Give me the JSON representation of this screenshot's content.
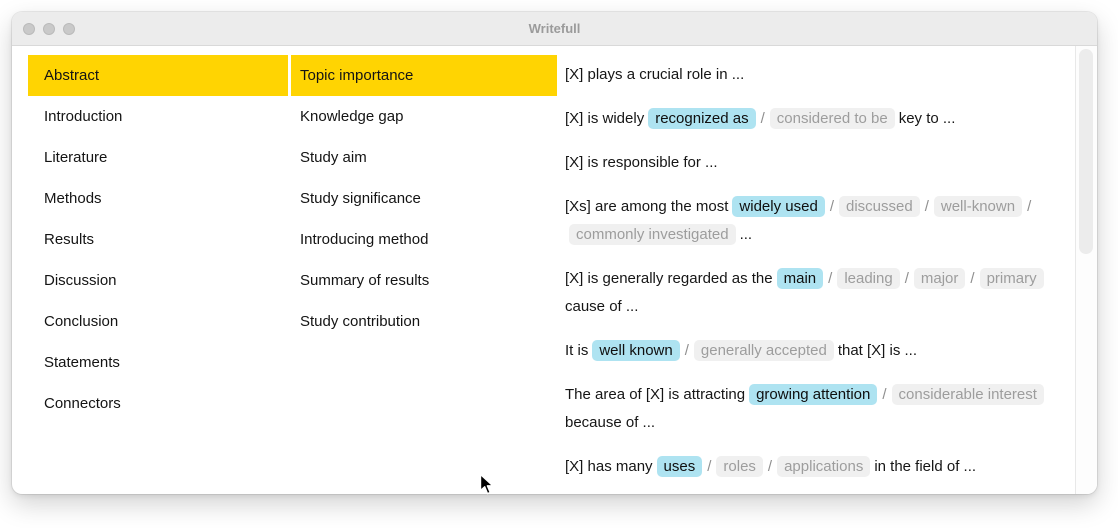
{
  "window": {
    "title": "Writefull",
    "controls": [
      "close",
      "minimize",
      "zoom"
    ]
  },
  "colors": {
    "selection_yellow": "#ffd402",
    "highlight_blue": "#aee3f1",
    "alternative_gray_bg": "#f0f0f0",
    "alternative_gray_text": "#9d9d9d",
    "titlebar_gray": "#ececec"
  },
  "icons": {
    "cursor": "arrow-pointer"
  },
  "sections": {
    "items": [
      {
        "label": "Abstract",
        "selected": true
      },
      {
        "label": "Introduction",
        "selected": false
      },
      {
        "label": "Literature",
        "selected": false
      },
      {
        "label": "Methods",
        "selected": false
      },
      {
        "label": "Results",
        "selected": false
      },
      {
        "label": "Discussion",
        "selected": false
      },
      {
        "label": "Conclusion",
        "selected": false
      },
      {
        "label": "Statements",
        "selected": false
      },
      {
        "label": "Connectors",
        "selected": false
      }
    ]
  },
  "topics": {
    "items": [
      {
        "label": "Topic importance",
        "selected": true
      },
      {
        "label": "Knowledge gap",
        "selected": false
      },
      {
        "label": "Study aim",
        "selected": false
      },
      {
        "label": "Study significance",
        "selected": false
      },
      {
        "label": "Introducing method",
        "selected": false
      },
      {
        "label": "Summary of results",
        "selected": false
      },
      {
        "label": "Study contribution",
        "selected": false
      }
    ]
  },
  "sentences": [
    {
      "segments": [
        {
          "text": "[X] plays a crucial role in ...",
          "type": "plain"
        }
      ]
    },
    {
      "segments": [
        {
          "text": "[X] is widely",
          "type": "plain"
        },
        {
          "text": "recognized as",
          "type": "highlight"
        },
        {
          "text": "/",
          "type": "separator"
        },
        {
          "text": "considered to be",
          "type": "alternative"
        },
        {
          "text": "key to ...",
          "type": "plain"
        }
      ]
    },
    {
      "segments": [
        {
          "text": "[X] is responsible for ...",
          "type": "plain"
        }
      ]
    },
    {
      "segments": [
        {
          "text": "[Xs] are among the most",
          "type": "plain"
        },
        {
          "text": "widely used",
          "type": "highlight"
        },
        {
          "text": "/",
          "type": "separator"
        },
        {
          "text": "discussed",
          "type": "alternative"
        },
        {
          "text": "/",
          "type": "separator"
        },
        {
          "text": "well-known",
          "type": "alternative"
        },
        {
          "text": "/",
          "type": "separator"
        },
        {
          "text": "commonly investigated",
          "type": "alternative"
        },
        {
          "text": "...",
          "type": "plain"
        }
      ]
    },
    {
      "segments": [
        {
          "text": "[X] is generally regarded as the",
          "type": "plain"
        },
        {
          "text": "main",
          "type": "highlight"
        },
        {
          "text": "/",
          "type": "separator"
        },
        {
          "text": "leading",
          "type": "alternative"
        },
        {
          "text": "/",
          "type": "separator"
        },
        {
          "text": "major",
          "type": "alternative"
        },
        {
          "text": "/",
          "type": "separator"
        },
        {
          "text": "primary",
          "type": "alternative"
        },
        {
          "text": "cause of ...",
          "type": "plain"
        }
      ]
    },
    {
      "segments": [
        {
          "text": "It is",
          "type": "plain"
        },
        {
          "text": "well known",
          "type": "highlight"
        },
        {
          "text": "/",
          "type": "separator"
        },
        {
          "text": "generally accepted",
          "type": "alternative"
        },
        {
          "text": "that [X] is ...",
          "type": "plain"
        }
      ]
    },
    {
      "segments": [
        {
          "text": "The area of [X] is attracting",
          "type": "plain"
        },
        {
          "text": "growing attention",
          "type": "highlight"
        },
        {
          "text": "/",
          "type": "separator"
        },
        {
          "text": "considerable interest",
          "type": "alternative"
        },
        {
          "text": "because of ...",
          "type": "plain"
        }
      ]
    },
    {
      "segments": [
        {
          "text": "[X] has many",
          "type": "plain"
        },
        {
          "text": "uses",
          "type": "highlight"
        },
        {
          "text": "/",
          "type": "separator"
        },
        {
          "text": "roles",
          "type": "alternative"
        },
        {
          "text": "/",
          "type": "separator"
        },
        {
          "text": "applications",
          "type": "alternative"
        },
        {
          "text": "in the field of ...",
          "type": "plain"
        }
      ]
    }
  ]
}
